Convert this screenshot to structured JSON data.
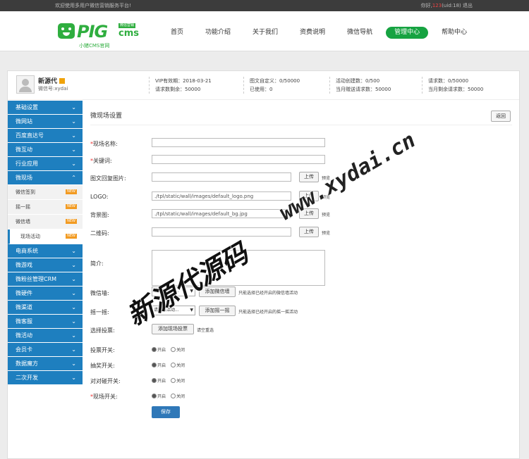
{
  "topbar": {
    "welcome": "欢迎使用多用户微信营销服务平台!",
    "greeting": "你好,",
    "username_red": "123",
    "uid": "(uid:18)",
    "logout": "退出"
  },
  "logo": {
    "text": "PIG",
    "cms": "cms",
    "badge": "微信营销",
    "subtitle": "小猪CMS官网"
  },
  "nav": {
    "items": [
      "首页",
      "功能介绍",
      "关于我们",
      "资费说明",
      "微信导航",
      "管理中心",
      "帮助中心"
    ],
    "active": "管理中心"
  },
  "profile": {
    "name": "新源代",
    "wechat_id": "微信号:xydai",
    "stats": [
      {
        "line1": "VIP有效期：2018-03-21",
        "line2": "请求数剩余：50000"
      },
      {
        "line1": "图文自定义：0/50000",
        "line2": "已使用：0"
      },
      {
        "line1": "活动创建数：0/500",
        "line2": "当月赠送请求数：50000"
      },
      {
        "line1": "请求数：0/50000",
        "line2": "当月剩余请求数：50000"
      }
    ]
  },
  "sidebar": {
    "items_top": [
      "基础设置",
      "微网站",
      "百度直达号",
      "微互动",
      "行业应用"
    ],
    "expanded": "微现场",
    "sub_items": [
      {
        "label": "微信签到",
        "badge": "NEW"
      },
      {
        "label": "摇一摇",
        "badge": "NEW"
      },
      {
        "label": "微信墙",
        "badge": "NEW"
      },
      {
        "label": "现场活动",
        "badge": "NEW"
      }
    ],
    "items_bottom": [
      "电商系统",
      "微游戏",
      "微粉丝管理CRM",
      "微硬件",
      "微渠道",
      "微客服",
      "微活动",
      "会员卡",
      "数据魔方",
      "二次开发"
    ]
  },
  "form": {
    "title": "微现场设置",
    "back": "返回",
    "name_label": "现场名称:",
    "keyword_label": "关键词:",
    "cover_label": "图文回复图片:",
    "logo_label": "LOGO:",
    "logo_value": "./tpl/static/wall/images/default_logo.png",
    "bg_label": "背景图:",
    "bg_value": "./tpl/static/wall/images/default_bg.jpg",
    "qr_label": "二维码:",
    "intro_label": "简介:",
    "upload": "上传",
    "preview": "预览",
    "wall_label": "微信墙:",
    "wall_select": "请选择活动...",
    "wall_add": "添加微信墙",
    "wall_note": "只能选择已经开启的微信墙活动",
    "shake_label": "摇一摇:",
    "shake_select": "请选择活动...",
    "shake_add": "添加摇一摇",
    "shake_note": "只能选择已经开启的摇一摇活动",
    "vote_label": "选择投票:",
    "vote_add": "添加现场投票",
    "vote_clear": "请空重选",
    "vote_switch_label": "投票开关:",
    "lottery_switch_label": "抽奖开关:",
    "pair_switch_label": "对对碰开关:",
    "site_switch_label": "现场开关:",
    "on": "开启",
    "off": "关闭",
    "save": "保存"
  },
  "watermark": {
    "url": "www.xydai.cn",
    "cn": "新源代源码"
  }
}
